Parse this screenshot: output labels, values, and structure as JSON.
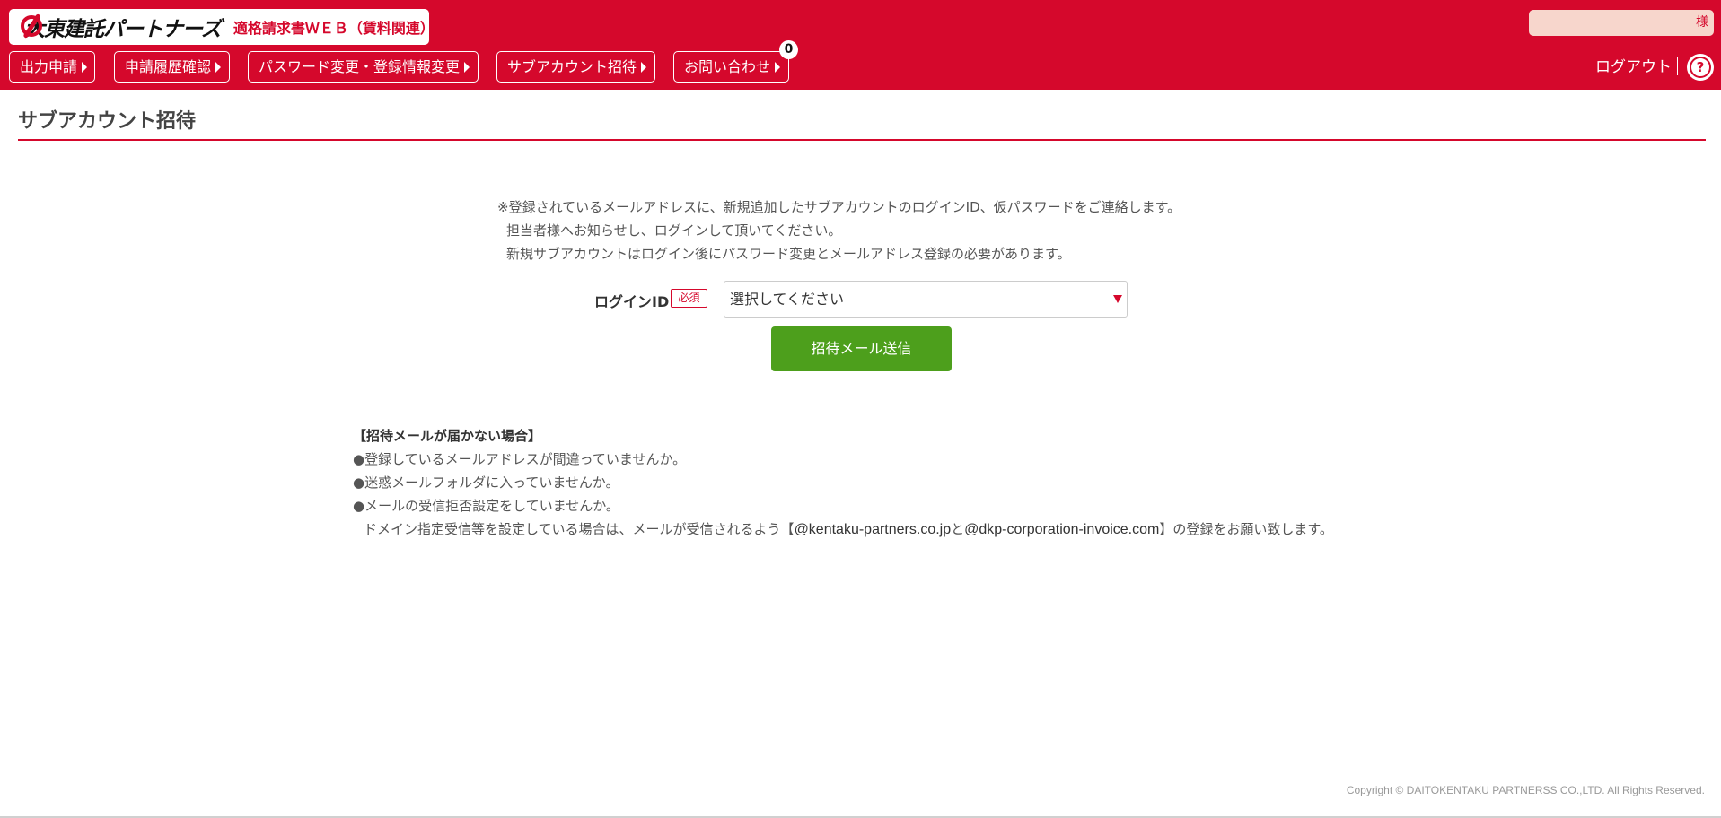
{
  "header": {
    "logo_name": "大東建託パートナーズ",
    "app_title": "適格請求書ＷＥＢ（賃料関連）",
    "user_suffix": "様",
    "logout_label": "ログアウト",
    "help_label": "?"
  },
  "nav": {
    "items": [
      {
        "label": "出力申請"
      },
      {
        "label": "申請履歴確認"
      },
      {
        "label": "パスワード変更・登録情報変更"
      },
      {
        "label": "サブアカウント招待"
      },
      {
        "label": "お問い合わせ"
      }
    ],
    "inquiry_badge": "0"
  },
  "page": {
    "title": "サブアカウント招待",
    "notes": [
      "※登録されているメールアドレスに、新規追加したサブアカウントのログインID、仮パスワードをご連絡します。",
      "担当者様へお知らせし、ログインして頂いてください。",
      "新規サブアカウントはログイン後にパスワード変更とメールアドレス登録の必要があります。"
    ],
    "form": {
      "login_id_label": "ログインID",
      "required_label": "必須",
      "select_value": "選択してください",
      "submit_label": "招待メール送信"
    },
    "troubleshoot": {
      "title": "【招待メールが届かない場合】",
      "items": [
        "●登録しているメールアドレスが間違っていませんか。",
        "●迷惑メールフォルダに入っていませんか。",
        "●メールの受信拒否設定をしていませんか。"
      ],
      "domain_note_prefix": "ドメイン指定受信等を設定している場合は、メールが受信されるよう【",
      "domain_1": "@kentaku-partners.co.jp",
      "domain_joiner": "と",
      "domain_2": "@dkp-corporation-invoice.com",
      "domain_note_suffix": "】の登録をお願い致します。"
    }
  },
  "footer": {
    "copyright": "Copyright © DAITOKENTAKU PARTNERSS CO.,LTD. All Rights Reserved."
  },
  "colors": {
    "brand_red": "#d5082c",
    "button_green": "#4d9f1c"
  }
}
